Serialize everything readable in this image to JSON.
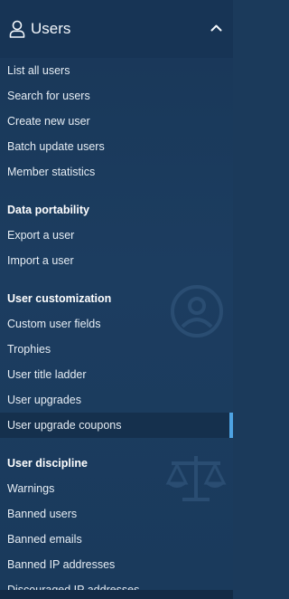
{
  "header": {
    "title": "Users",
    "icon": "user-icon",
    "toggle_icon": "chevron-up-icon"
  },
  "groups": [
    {
      "heading": "",
      "items": [
        "List all users",
        "Search for users",
        "Create new user",
        "Batch update users",
        "Member statistics"
      ]
    },
    {
      "heading": "Data portability",
      "items": [
        "Export a user",
        "Import a user"
      ]
    },
    {
      "heading": "User customization",
      "items": [
        "Custom user fields",
        "Trophies",
        "User title ladder",
        "User upgrades",
        "User upgrade coupons"
      ]
    },
    {
      "heading": "User discipline",
      "items": [
        "Warnings",
        "Banned users",
        "Banned emails",
        "Banned IP addresses",
        "Discouraged IP addresses"
      ]
    }
  ],
  "active_item": "User upgrade coupons",
  "colors": {
    "background": "#1b3a5b",
    "active_bar": "#4ea3e3",
    "text": "#e6edf4"
  }
}
